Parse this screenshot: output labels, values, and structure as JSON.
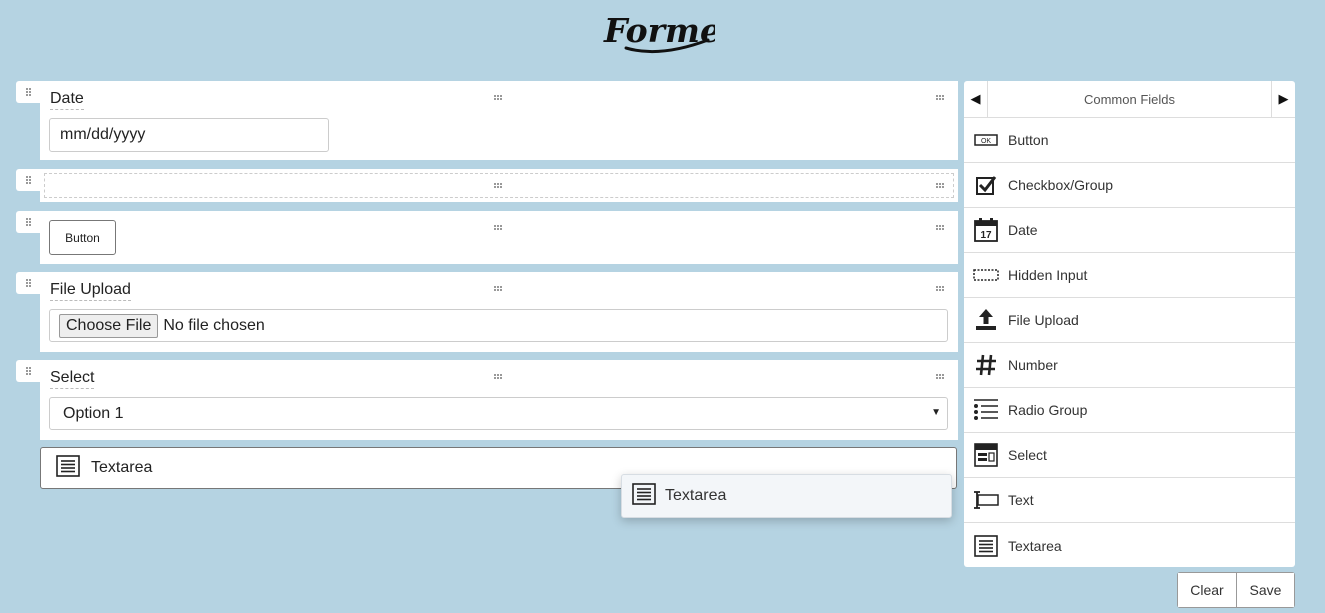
{
  "brand": {
    "logo_text": "Formeo"
  },
  "stage": {
    "rows": [
      {
        "type": "date",
        "label": "Date",
        "placeholder": "mm/dd/yyyy"
      },
      {
        "type": "empty"
      },
      {
        "type": "button",
        "button_label": "Button"
      },
      {
        "type": "file",
        "label": "File Upload",
        "choose_label": "Choose File",
        "status": "No file chosen"
      },
      {
        "type": "select",
        "label": "Select",
        "selected": "Option 1"
      }
    ],
    "drop_placeholder": {
      "label": "Textarea",
      "icon": "textarea-icon"
    },
    "drag_ghost": {
      "label": "Textarea",
      "icon": "textarea-icon"
    }
  },
  "panel": {
    "title": "Common Fields",
    "prev_icon": "caret-left-icon",
    "next_icon": "caret-right-icon",
    "controls": [
      {
        "label": "Button",
        "icon": "button-icon"
      },
      {
        "label": "Checkbox/Group",
        "icon": "checkbox-icon"
      },
      {
        "label": "Date",
        "icon": "calendar-icon"
      },
      {
        "label": "Hidden Input",
        "icon": "hidden-input-icon"
      },
      {
        "label": "File Upload",
        "icon": "upload-icon"
      },
      {
        "label": "Number",
        "icon": "hash-icon"
      },
      {
        "label": "Radio Group",
        "icon": "radio-group-icon"
      },
      {
        "label": "Select",
        "icon": "select-icon"
      },
      {
        "label": "Text",
        "icon": "text-input-icon"
      },
      {
        "label": "Textarea",
        "icon": "textarea-icon"
      }
    ],
    "calendar_day": "17",
    "button_icon_text": "OK"
  },
  "actions": {
    "clear_label": "Clear",
    "save_label": "Save"
  }
}
